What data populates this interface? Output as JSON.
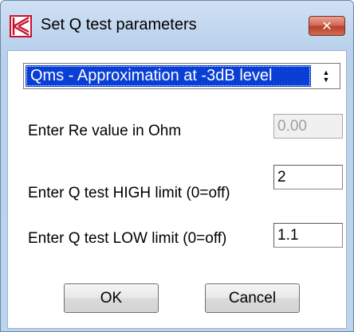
{
  "window": {
    "title": "Set Q test parameters",
    "close_label": "✕"
  },
  "method": {
    "selected": "Qms - Approximation at -3dB level"
  },
  "fields": {
    "re_label": "Enter Re value in Ohm",
    "re_value": "0.00",
    "high_label": "Enter Q test HIGH limit  (0=off)",
    "high_value": "2",
    "low_label": "Enter Q test LOW limit  (0=off)",
    "low_value": "1.1"
  },
  "buttons": {
    "ok_label": "OK",
    "cancel_label": "Cancel"
  },
  "icons": {
    "app": "app-logo-icon",
    "close": "close-icon",
    "spinner_up": "spin-up-icon",
    "spinner_down": "spin-down-icon"
  },
  "colors": {
    "selection": "#0a3fd6",
    "close_button": "#c75a45",
    "logo_red": "#c8102e"
  }
}
